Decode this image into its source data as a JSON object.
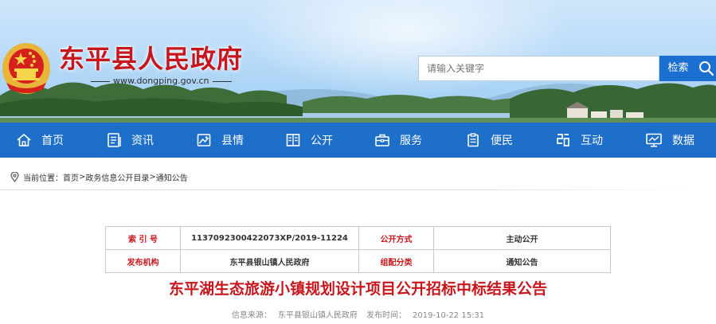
{
  "header": {
    "site_title": "东平县人民政府",
    "site_url": "www.dongping.gov.cn",
    "search_placeholder": "请输入关键字",
    "search_button": "检索"
  },
  "nav": {
    "items": [
      {
        "label": "首页",
        "icon": "home-icon"
      },
      {
        "label": "资讯",
        "icon": "news-icon"
      },
      {
        "label": "县情",
        "icon": "county-info-icon"
      },
      {
        "label": "公开",
        "icon": "disclosure-icon"
      },
      {
        "label": "服务",
        "icon": "briefcase-icon"
      },
      {
        "label": "便民",
        "icon": "clipboard-icon"
      },
      {
        "label": "互动",
        "icon": "interaction-icon"
      },
      {
        "label": "数据",
        "icon": "monitor-icon"
      }
    ]
  },
  "breadcrumb": {
    "prefix": "当前位置：",
    "items": [
      "首页",
      "政务信息公开目录",
      "通知公告"
    ],
    "separator": ">"
  },
  "info_table": {
    "rows": [
      [
        {
          "key": "索 引 号",
          "value": "1137092300422073XP/2019-11224"
        },
        {
          "key": "公开方式",
          "value": "主动公开"
        }
      ],
      [
        {
          "key": "发布机构",
          "value": "东平县银山镇人民政府"
        },
        {
          "key": "组配分类",
          "value": "通知公告"
        }
      ]
    ]
  },
  "article": {
    "title": "东平湖生态旅游小镇规划设计项目公开招标中标结果公告",
    "source_label": "信息来源：",
    "source": "东平县银山镇人民政府",
    "time_label": "发布时间：",
    "time": "2019-10-22 15:31"
  },
  "colors": {
    "brand_red": "#c8161d",
    "nav_blue": "#1e6fc9",
    "search_blue": "#1a6fd0"
  }
}
